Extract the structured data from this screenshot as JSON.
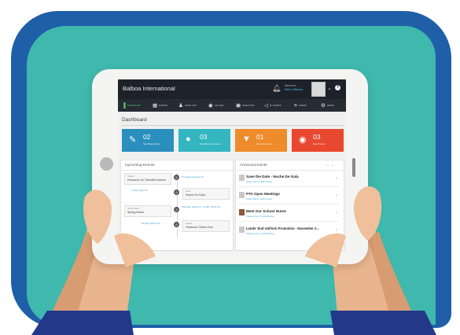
{
  "header": {
    "title": "Balboa International",
    "welcome": "Welcome",
    "user_name": "Mike Williams"
  },
  "nav": {
    "items": [
      {
        "label": "DASHBOARD",
        "icon": "chart-icon"
      },
      {
        "label": "EVENTS",
        "icon": "calendar-icon"
      },
      {
        "label": "STAFF LIST",
        "icon": "people-icon"
      },
      {
        "label": "GALLERY",
        "icon": "camera-icon"
      },
      {
        "label": "DIRECTORY",
        "icon": "book-icon"
      },
      {
        "label": "MY MARKS",
        "icon": "megaphone-icon"
      },
      {
        "label": "FORMS",
        "icon": "list-icon"
      },
      {
        "label": "ADMIN",
        "icon": "gears-icon"
      }
    ],
    "active": "DASHBOARD"
  },
  "dashboard": {
    "title": "Dashboard",
    "tiles": [
      {
        "value": "02",
        "label": "New Blog Entries",
        "color": "#2a8fbd",
        "icon": "pencil-icon"
      },
      {
        "value": "03",
        "label": "New Blog Comments",
        "color": "#34b6c0",
        "icon": "chat-icon"
      },
      {
        "value": "01",
        "label": "New Inbox Items",
        "color": "#ee8b2a",
        "icon": "inbox-icon"
      },
      {
        "value": "03",
        "label": "New Photos",
        "color": "#e8482f",
        "icon": "camera-icon"
      }
    ]
  },
  "upcoming": {
    "title": "Upcoming Events",
    "events": [
      {
        "date": "Tuesday, February 24",
        "small": "Teacher",
        "title": "Research On Scientific Dames"
      },
      {
        "date": "Friday, March 6",
        "small": "Event",
        "title": "Noche De Gala"
      },
      {
        "date": "Saturday, March 14 - Friday, March 20",
        "small": "School Closed",
        "title": "Spring Break"
      },
      {
        "date": "Monday, March 23",
        "small": "Teacher",
        "title": "Yearbook Orders Due"
      }
    ]
  },
  "announcements": {
    "title": "Announcements",
    "items": [
      {
        "title": "Save the Date - Noche De Gala",
        "date": "Friday, Feb 27, 2015 6:12am"
      },
      {
        "title": "PTA Open Meetings",
        "date": "Friday, Feb 27, 2015 6:12am"
      },
      {
        "title": "Meet Our School Nurse",
        "date": "Tuesday, Feb 17, 2015 8:00am"
      },
      {
        "title": "Lands' End Uniform Promotion - November 2...",
        "date": "Tuesday, Feb 17, 2015 8:00am"
      }
    ]
  },
  "colors": {
    "frame_blue": "#1f5fa8",
    "background_teal": "#3fb8ad",
    "header_dark": "#1d2129",
    "nav_active_green": "#57c567",
    "link_blue": "#3a9fd8"
  }
}
